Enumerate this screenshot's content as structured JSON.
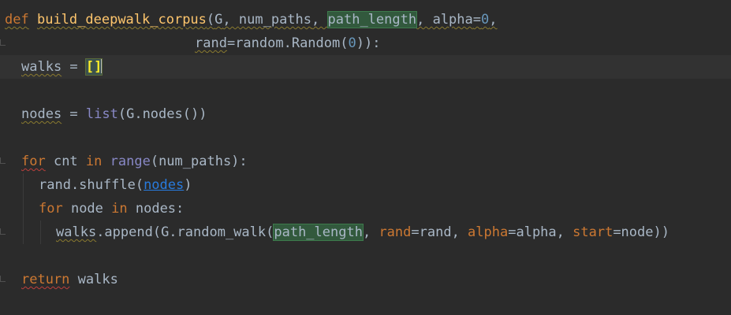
{
  "editor": {
    "line1": {
      "def": "def",
      "fname": "build_deepwalk_corpus",
      "open": "(",
      "g": "G",
      "comma1": ", ",
      "num_paths": "num_paths",
      "comma2": ", ",
      "path_length": "path_length",
      "comma3": ", ",
      "alpha": "alpha",
      "eq": "=",
      "zero": "0",
      "comma4": ","
    },
    "line2": {
      "rand": "rand",
      "eq_random": "=random.Random(",
      "zero": "0",
      "close": ")):"
    },
    "line3": {
      "walks": "walks",
      "eq": " = ",
      "brackets": "[]"
    },
    "line4": {
      "nodes": "nodes",
      "eq": " = ",
      "list": "list",
      "rest": "(G.nodes())"
    },
    "line5": {
      "for": "for",
      "cnt": " cnt ",
      "in": "in",
      "space": " ",
      "range": "range",
      "rest": "(num_paths):"
    },
    "line6": {
      "pre": "rand.shuffle(",
      "nodes": "nodes",
      "post": ")"
    },
    "line7": {
      "for": "for",
      "node": " node ",
      "in": "in",
      "rest": " nodes:"
    },
    "line8": {
      "walks": "walks",
      "call": ".append(G.random_walk(",
      "path_length": "path_length",
      "comma1": ", ",
      "rand_kw": "rand",
      "rand_val": "=rand, ",
      "alpha_kw": "alpha",
      "alpha_val": "=alpha, ",
      "start_kw": "start",
      "start_val": "=node))"
    },
    "line9": {
      "return": "return",
      "walks": " walks"
    }
  }
}
